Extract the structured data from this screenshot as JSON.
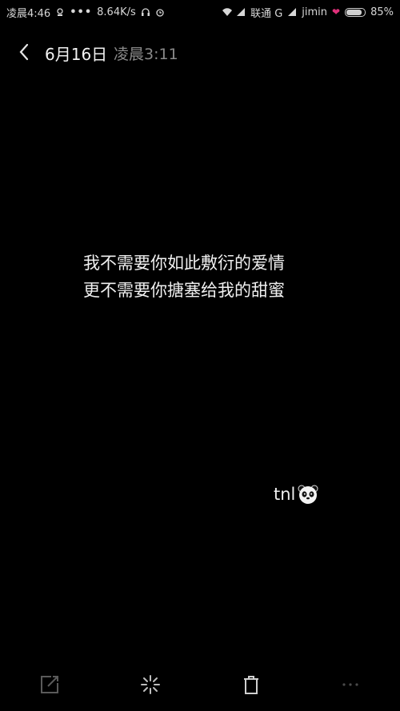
{
  "status_bar": {
    "time": "凌晨4:46",
    "speed": "8.64K/s",
    "carrier": "联通 G",
    "user": "jimin",
    "battery": "85%",
    "battery_level": 0.85
  },
  "header": {
    "date": "6月16日",
    "time": "凌晨3:11"
  },
  "content": {
    "lines": [
      "我不需要你如此敷衍的爱情",
      "更不需要你搪塞给我的甜蜜"
    ],
    "signature": "tnl"
  },
  "toolbar": {
    "icons": [
      "share-icon",
      "sparkle-icon",
      "trash-icon",
      "more-icon"
    ]
  },
  "colors": {
    "background": "#000000",
    "text": "#f0f0f0",
    "muted": "#8a8a8a",
    "heart": "#e0307a"
  }
}
